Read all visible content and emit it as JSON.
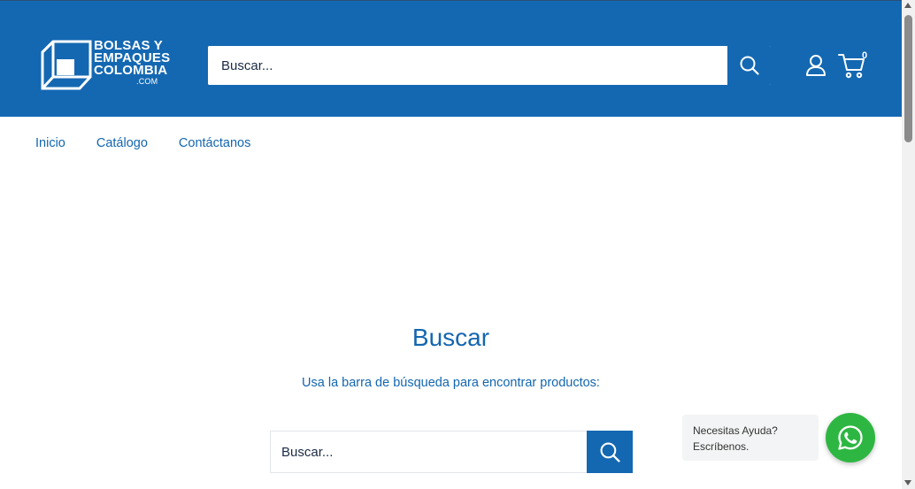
{
  "brand": {
    "line1": "BOLSAS Y",
    "line2": "EMPAQUES",
    "line3": "COLOMBIA",
    "suffix": ".COM"
  },
  "header": {
    "search_placeholder": "Buscar...",
    "search_icon": "search-icon",
    "account_icon": "user-icon",
    "cart_icon": "cart-icon",
    "cart_count": "0"
  },
  "nav": {
    "items": [
      {
        "label": "Inicio"
      },
      {
        "label": "Catálogo"
      },
      {
        "label": "Contáctanos"
      }
    ]
  },
  "main": {
    "title": "Buscar",
    "subtitle": "Usa la barra de búsqueda para encontrar productos:",
    "search_placeholder": "Buscar..."
  },
  "whatsapp": {
    "line1": "Necesitas Ayuda?",
    "line2": "Escríbenos.",
    "icon": "whatsapp-icon"
  },
  "colors": {
    "primary": "#1468b2",
    "text": "#1366b0",
    "whatsapp": "#2db742"
  }
}
